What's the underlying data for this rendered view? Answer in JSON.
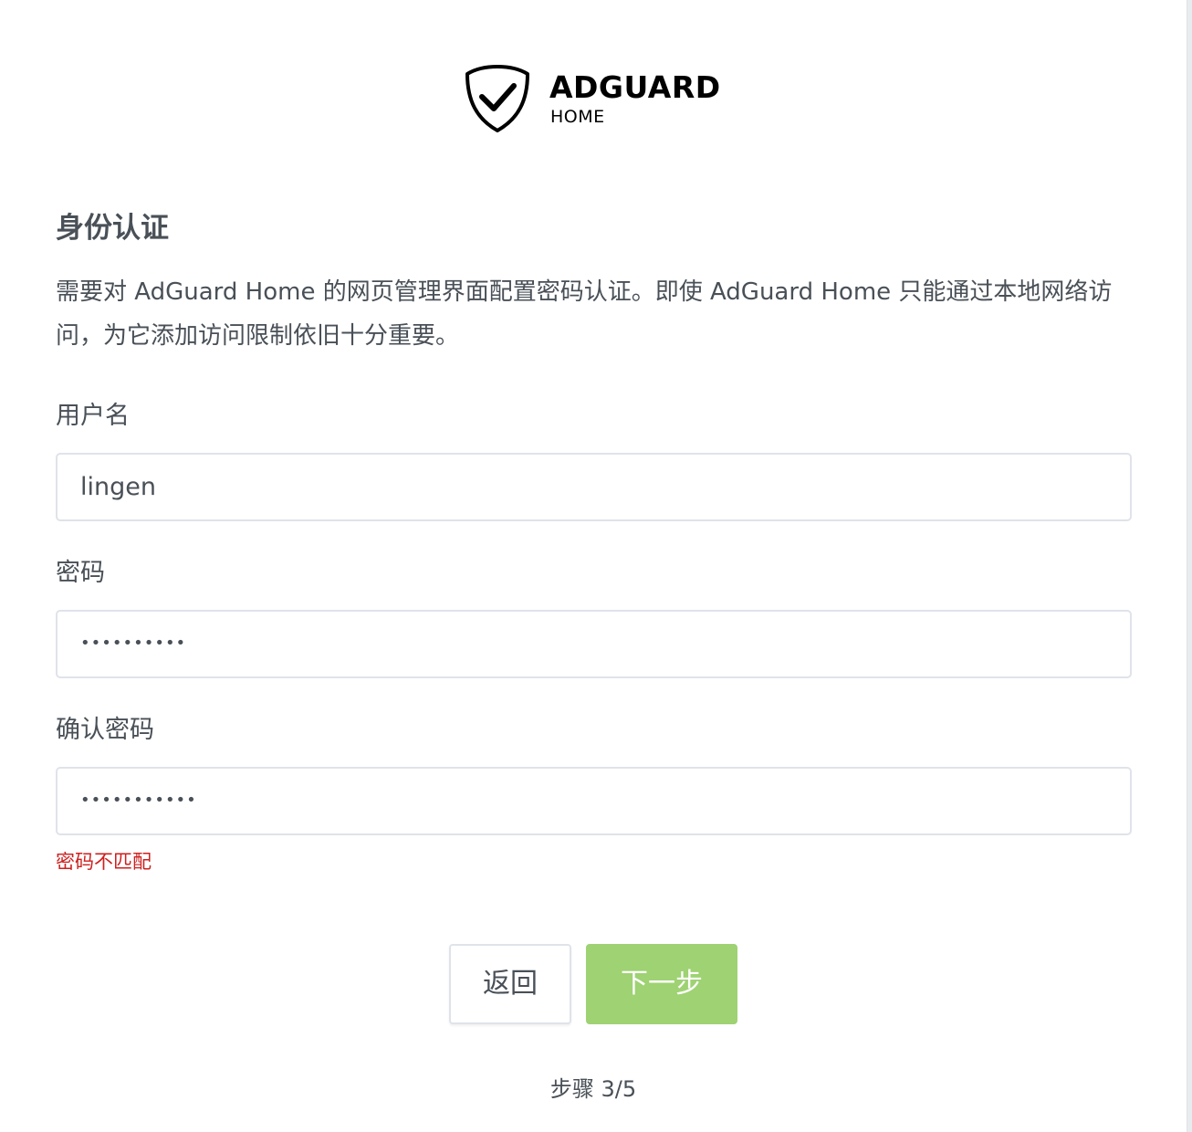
{
  "brand": {
    "title": "ADGUARD",
    "subtitle": "HOME",
    "logo_icon": "shield-check-icon"
  },
  "page": {
    "title": "身份认证",
    "description": "需要对 AdGuard Home 的网页管理界面配置密码认证。即使 AdGuard Home 只能通过本地网络访问，为它添加访问限制依旧十分重要。"
  },
  "form": {
    "username": {
      "label": "用户名",
      "value": "lingen"
    },
    "password": {
      "label": "密码",
      "value": "••••••••••"
    },
    "confirm_password": {
      "label": "确认密码",
      "value": "•••••••••••",
      "error": "密码不匹配"
    }
  },
  "buttons": {
    "back_label": "返回",
    "next_label": "下一步"
  },
  "footer": {
    "step_text": "步骤 3/5"
  },
  "colors": {
    "text": "#495057",
    "error": "#cd201f",
    "next_button": "#9ed272",
    "input_border": "#dfe3ea"
  }
}
